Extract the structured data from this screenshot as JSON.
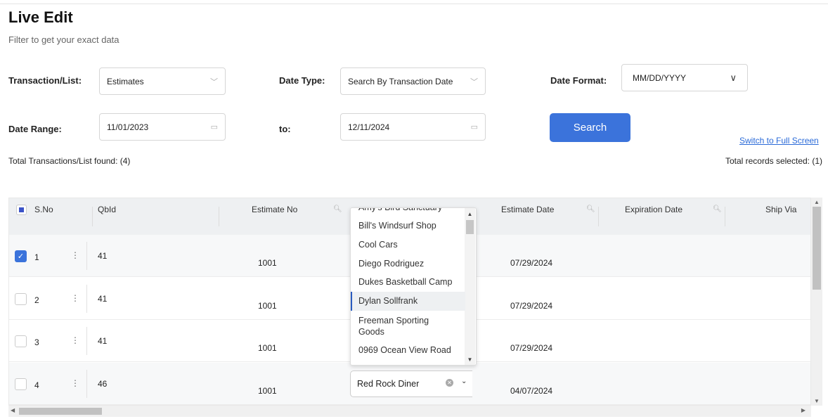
{
  "header": {
    "title": "Live Edit",
    "subtitle": "Filter to get your exact data"
  },
  "filters": {
    "transaction_label": "Transaction/List:",
    "transaction_value": "Estimates",
    "date_type_label": "Date Type:",
    "date_type_value": "Search By Transaction Date",
    "date_format_label": "Date Format:",
    "date_format_value": "MM/DD/YYYY",
    "date_range_label": "Date Range:",
    "date_from": "11/01/2023",
    "to_label": "to:",
    "date_to": "12/11/2024",
    "search_label": "Search",
    "fullscreen_label": "Switch to Full Screen"
  },
  "summary": {
    "found": "Total Transactions/List found: (4)",
    "selected": "Total records selected: (1)"
  },
  "table": {
    "columns": [
      "S.No",
      "QbId",
      "Estimate No",
      "Estimate Date",
      "Expiration Date",
      "Ship Via"
    ],
    "rows": [
      {
        "sno": "1",
        "qbid": "41",
        "estimate_no": "1001",
        "estimate_date": "07/29/2024",
        "checked": true
      },
      {
        "sno": "2",
        "qbid": "41",
        "estimate_no": "1001",
        "estimate_date": "07/29/2024",
        "checked": false
      },
      {
        "sno": "3",
        "qbid": "41",
        "estimate_no": "1001",
        "estimate_date": "07/29/2024",
        "checked": false
      },
      {
        "sno": "4",
        "qbid": "46",
        "estimate_no": "1001",
        "estimate_date": "04/07/2024",
        "checked": false
      }
    ],
    "customer_select_value": "Red Rock Diner"
  },
  "dropdown": {
    "options": [
      "Amy's Bird Sanctuary",
      "Bill's Windsurf Shop",
      "Cool Cars",
      "Diego Rodriguez",
      "Dukes Basketball Camp",
      "Dylan Sollfrank",
      "Freeman Sporting Goods",
      "0969 Ocean View Road"
    ],
    "highlighted": "Dylan Sollfrank"
  },
  "colors": {
    "accent": "#3b73db",
    "header_bg": "#eef0f2"
  }
}
